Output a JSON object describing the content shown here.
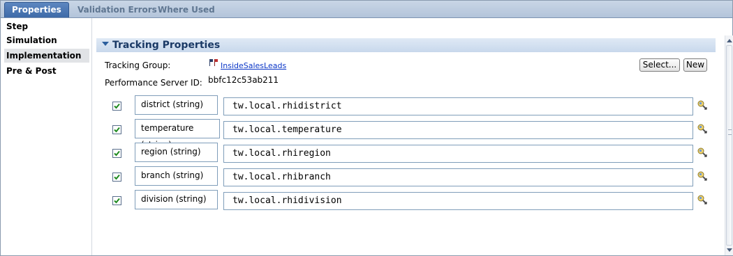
{
  "tabs": [
    {
      "label": "Properties",
      "active": true
    },
    {
      "label": "Validation Errors",
      "active": false
    },
    {
      "label": "Where Used",
      "active": false
    }
  ],
  "nav": {
    "items": [
      {
        "label": "Step"
      },
      {
        "label": "Simulation"
      },
      {
        "label": "Implementation",
        "selected": true
      },
      {
        "label": "Pre & Post"
      }
    ]
  },
  "section": {
    "title": "Tracking Properties",
    "tracking_group_label": "Tracking Group:",
    "tracking_group_value": "InsideSalesLeads",
    "server_id_label": "Performance Server ID:",
    "server_id_value": "bbfc12c53ab211",
    "select_button": "Select...",
    "new_button": "New"
  },
  "fields": [
    {
      "checked": true,
      "name": "district (string)",
      "value": "tw.local.rhidistrict"
    },
    {
      "checked": true,
      "name": "temperature (string)",
      "value": "tw.local.temperature"
    },
    {
      "checked": true,
      "name": "region (string)",
      "value": "tw.local.rhiregion"
    },
    {
      "checked": true,
      "name": "branch (string)",
      "value": "tw.local.rhibranch"
    },
    {
      "checked": true,
      "name": "division (string)",
      "value": "tw.local.rhidivision"
    }
  ],
  "colors": {
    "active_tab": "#4a76b2",
    "section_header": "#d4e1f1",
    "link": "#0a36c7",
    "checkmark": "#1f8a1f"
  }
}
